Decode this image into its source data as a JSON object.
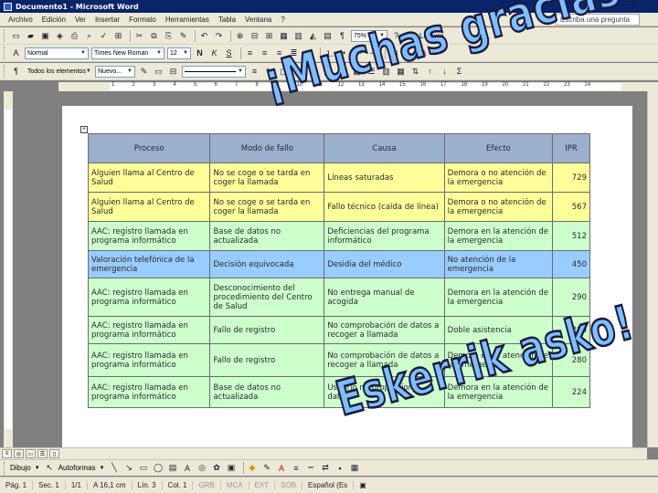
{
  "window": {
    "title": "Documento1 - Microsoft Word"
  },
  "menu": {
    "items": [
      "Archivo",
      "Edición",
      "Ver",
      "Insertar",
      "Formato",
      "Herramientas",
      "Tabla",
      "Ventana",
      "?"
    ],
    "ask_placeholder": "Escriba una pregunta"
  },
  "toolbar_standard": {
    "zoom": "75%",
    "read_label": "Lectura"
  },
  "toolbar_format": {
    "style": "Normal",
    "font": "Times New Roman",
    "size": "12"
  },
  "toolbar_tables": {
    "all_elements": "Todos los elementos",
    "new_label": "Nuevo...",
    "sum_symbol": "Σ"
  },
  "ruler": {
    "labels": [
      "1",
      "2",
      "3",
      "4",
      "5",
      "6",
      "7",
      "8",
      "9",
      "10",
      "11",
      "12",
      "13",
      "14",
      "15",
      "16",
      "17",
      "18",
      "19",
      "20",
      "21",
      "22",
      "23",
      "24"
    ]
  },
  "table": {
    "headers": [
      "Proceso",
      "Modo de fallo",
      "Causa",
      "Efecto",
      "IPR"
    ],
    "rows": [
      {
        "style": "yellow",
        "cells": [
          "Alguien llama al Centro de Salud",
          "No se coge o se tarda en coger la llamada",
          "Líneas saturadas",
          "Demora o no atención de la emergencia",
          "729"
        ]
      },
      {
        "style": "yellow",
        "cells": [
          "Alguien llama al Centro de Salud",
          "No se coge o se tarda en coger la llamada",
          "Fallo técnico (caída de línea)",
          "Demora o no atención de la emergencia",
          "567"
        ]
      },
      {
        "style": "green",
        "cells": [
          "AAC: registro llamada en programa informático",
          "Base de datos no actualizada",
          "Deficiencias del programa informático",
          "Demora en la atención de la emergencia",
          "512"
        ]
      },
      {
        "style": "blue",
        "cells": [
          "Valoración telefónica de la emergencia",
          "Decisión equivocada",
          "Desidia del médico",
          "No atención de la emergencia",
          "450"
        ]
      },
      {
        "style": "green",
        "cells": [
          "AAC: registro llamada en programa informático",
          "Desconocimiento del procedimiento del Centro de Salud",
          "No entrega manual de acogida",
          "Demora en la atención de la emergencia",
          "290"
        ]
      },
      {
        "style": "green",
        "cells": [
          "AAC: registro llamada en programa informático",
          "Fallo de registro",
          "No comprobación de datos a recoger a llamada",
          "Doble asistencia",
          "280"
        ]
      },
      {
        "style": "green",
        "cells": [
          "AAC: registro llamada en programa informático",
          "Fallo de registro",
          "No comprobación de datos a recoger a llamada",
          "Demora en la atención de la emergencia",
          "280"
        ]
      },
      {
        "style": "green",
        "cells": [
          "AAC: registro llamada en programa informático",
          "Base de datos no actualizada",
          "Usuario no proporciona datos",
          "Demora en la atención de la emergencia",
          "224"
        ]
      }
    ]
  },
  "wordart": {
    "top": "¡Muchas gracias!",
    "bottom": "Eskerrik asko!"
  },
  "drawing": {
    "draw_label": "Dibujo",
    "autoshapes_label": "Autoformas"
  },
  "status": {
    "page": "Pág. 1",
    "section": "Sec. 1",
    "pages": "1/1",
    "position": "A 16,1 cm",
    "line": "Lín. 3",
    "column": "Col. 1",
    "grb": "GRB",
    "mca": "MCA",
    "ext": "EXT",
    "sob": "SOB",
    "language": "Español (Es"
  }
}
